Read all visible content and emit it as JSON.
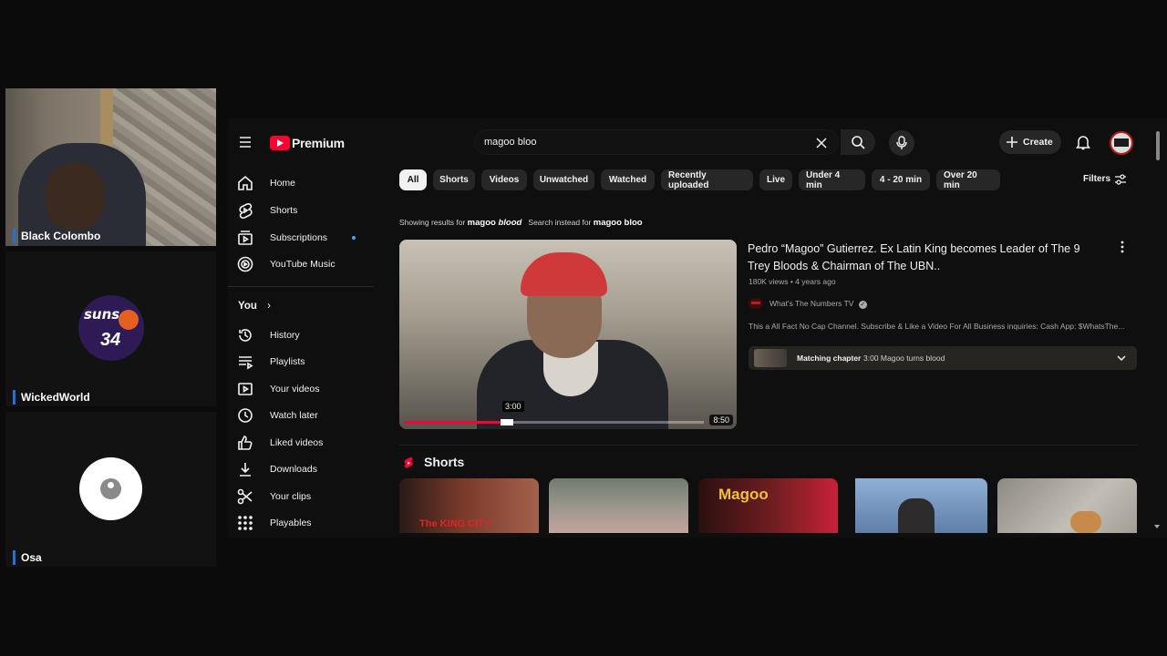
{
  "participants": [
    {
      "name": "Black Colombo"
    },
    {
      "name": "WickedWorld",
      "logo_text": "suns",
      "logo_number": "34"
    },
    {
      "name": "Osa"
    }
  ],
  "youtube": {
    "brand": "Premium",
    "search": {
      "value": "magoo bloo"
    },
    "header": {
      "create_label": "Create"
    },
    "sidebar": {
      "main": [
        {
          "label": "Home",
          "icon": "home-icon"
        },
        {
          "label": "Shorts",
          "icon": "shorts-icon"
        },
        {
          "label": "Subscriptions",
          "icon": "subscriptions-icon"
        },
        {
          "label": "YouTube Music",
          "icon": "music-icon"
        }
      ],
      "you_label": "You",
      "you": [
        {
          "label": "History",
          "icon": "history-icon"
        },
        {
          "label": "Playlists",
          "icon": "playlists-icon"
        },
        {
          "label": "Your videos",
          "icon": "your-videos-icon"
        },
        {
          "label": "Watch later",
          "icon": "watch-later-icon"
        },
        {
          "label": "Liked videos",
          "icon": "like-icon"
        },
        {
          "label": "Downloads",
          "icon": "download-icon"
        },
        {
          "label": "Your clips",
          "icon": "scissors-icon"
        },
        {
          "label": "Playables",
          "icon": "playables-icon"
        }
      ]
    },
    "chips": [
      "All",
      "Shorts",
      "Videos",
      "Unwatched",
      "Watched",
      "Recently uploaded",
      "Live",
      "Under 4 min",
      "4 - 20 min",
      "Over 20 min"
    ],
    "filters_label": "Filters",
    "correction": {
      "showing_prefix": "Showing results for",
      "query_plain": "magoo",
      "query_italic": "blood",
      "instead_prefix": "Search instead for",
      "instead_query": "magoo bloo"
    },
    "result": {
      "title_line1": "Pedro “Magoo” Gutierrez. Ex Latin King becomes Leader of The 9",
      "title_line2": "Trey Bloods & Chairman of The UBN..",
      "meta": "180K views • 4 years ago",
      "channel": "What's The Numbers TV",
      "description": "This a All Fact No Cap Channel. Subscribe & Like a Video For All Business inquiries: Cash App: $WhatsThe...",
      "chapter_label": "Matching chapter",
      "chapter_text": "3:00 Magoo turns blood",
      "duration": "8:50",
      "timestamp": "3:00",
      "progress": 0.34
    },
    "shorts_label": "Shorts",
    "shorts": [
      {
        "overlay": "The KING CITY",
        "color": "#5a2d22"
      },
      {
        "overlay": "",
        "color": "#8d8a80"
      },
      {
        "overlay": "Magoo",
        "color": "#7a1f22"
      },
      {
        "overlay": "",
        "color": "#6e8db5"
      },
      {
        "overlay": "",
        "color": "#a8a49c"
      }
    ]
  }
}
